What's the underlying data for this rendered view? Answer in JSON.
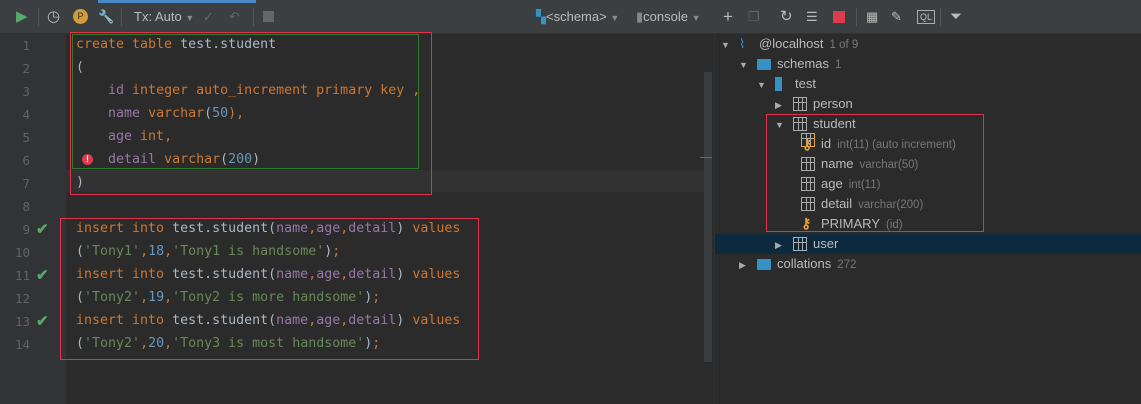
{
  "toolbar": {
    "tx_mode": "Tx: Auto",
    "schema": "<schema>",
    "console": "console"
  },
  "editor": {
    "lines": [
      [
        [
          "create table ",
          "kw"
        ],
        [
          "test.student",
          "id"
        ]
      ],
      [
        [
          "(",
          "id"
        ]
      ],
      [
        [
          "    id ",
          "col"
        ],
        [
          "integer auto_increment primary key ,",
          "kw"
        ]
      ],
      [
        [
          "    name ",
          "col"
        ],
        [
          "varchar",
          "kw"
        ],
        [
          "(",
          "id"
        ],
        [
          "50",
          "num"
        ],
        [
          "),",
          "kw"
        ]
      ],
      [
        [
          "    age ",
          "col"
        ],
        [
          "int,",
          "kw"
        ]
      ],
      [
        [
          "    detail ",
          "col"
        ],
        [
          "varchar",
          "kw"
        ],
        [
          "(",
          "id"
        ],
        [
          "200",
          "num"
        ],
        [
          ")",
          "id"
        ]
      ],
      [
        [
          ")",
          "id"
        ]
      ],
      [],
      [
        [
          "insert into ",
          "kw"
        ],
        [
          "test.student(",
          "id"
        ],
        [
          "name",
          "col"
        ],
        [
          ",",
          "kw"
        ],
        [
          "age",
          "col"
        ],
        [
          ",",
          "kw"
        ],
        [
          "detail",
          "col"
        ],
        [
          ") ",
          "id"
        ],
        [
          "values",
          "kw"
        ]
      ],
      [
        [
          "(",
          "id"
        ],
        [
          "'Tony1'",
          "str"
        ],
        [
          ",",
          "kw"
        ],
        [
          "18",
          "num"
        ],
        [
          ",",
          "kw"
        ],
        [
          "'Tony1 is handsome'",
          "str"
        ],
        [
          ")",
          "id"
        ],
        [
          ";",
          "kw"
        ]
      ],
      [
        [
          "insert into ",
          "kw"
        ],
        [
          "test.student(",
          "id"
        ],
        [
          "name",
          "col"
        ],
        [
          ",",
          "kw"
        ],
        [
          "age",
          "col"
        ],
        [
          ",",
          "kw"
        ],
        [
          "detail",
          "col"
        ],
        [
          ") ",
          "id"
        ],
        [
          "values",
          "kw"
        ]
      ],
      [
        [
          "(",
          "id"
        ],
        [
          "'Tony2'",
          "str"
        ],
        [
          ",",
          "kw"
        ],
        [
          "19",
          "num"
        ],
        [
          ",",
          "kw"
        ],
        [
          "'Tony2 is more handsome'",
          "str"
        ],
        [
          ")",
          "id"
        ],
        [
          ";",
          "kw"
        ]
      ],
      [
        [
          "insert into ",
          "kw"
        ],
        [
          "test.student(",
          "id"
        ],
        [
          "name",
          "col"
        ],
        [
          ",",
          "kw"
        ],
        [
          "age",
          "col"
        ],
        [
          ",",
          "kw"
        ],
        [
          "detail",
          "col"
        ],
        [
          ") ",
          "id"
        ],
        [
          "values",
          "kw"
        ]
      ],
      [
        [
          "(",
          "id"
        ],
        [
          "'Tony2'",
          "str"
        ],
        [
          ",",
          "kw"
        ],
        [
          "20",
          "num"
        ],
        [
          ",",
          "kw"
        ],
        [
          "'Tony3 is most handsome'",
          "str"
        ],
        [
          ")",
          "id"
        ],
        [
          ";",
          "kw"
        ]
      ]
    ],
    "success_lines": [
      9,
      11,
      13
    ],
    "error_line": 6
  },
  "tree": [
    {
      "label": "@localhost",
      "meta": "1 of 9",
      "depth": 0,
      "arrow": "down",
      "icon": "host"
    },
    {
      "label": "schemas",
      "meta": "1",
      "depth": 1,
      "arrow": "down",
      "icon": "folder"
    },
    {
      "label": "test",
      "meta": "",
      "depth": 2,
      "arrow": "down",
      "icon": "schema"
    },
    {
      "label": "person",
      "meta": "",
      "depth": 3,
      "arrow": "right",
      "icon": "table"
    },
    {
      "label": "student",
      "meta": "",
      "depth": 3,
      "arrow": "down",
      "icon": "table"
    },
    {
      "label": "id",
      "meta": "int(11) (auto increment)",
      "depth": 4,
      "icon": "pk-column"
    },
    {
      "label": "name",
      "meta": "varchar(50)",
      "depth": 4,
      "icon": "column"
    },
    {
      "label": "age",
      "meta": "int(11)",
      "depth": 4,
      "icon": "column"
    },
    {
      "label": "detail",
      "meta": "varchar(200)",
      "depth": 4,
      "icon": "column"
    },
    {
      "label": "PRIMARY",
      "meta": "(id)",
      "depth": 4,
      "icon": "key"
    },
    {
      "label": "user",
      "meta": "",
      "depth": 3,
      "arrow": "right",
      "icon": "table",
      "selected": true
    },
    {
      "label": "collations",
      "meta": "272",
      "depth": 1,
      "arrow": "right",
      "icon": "folder"
    }
  ]
}
